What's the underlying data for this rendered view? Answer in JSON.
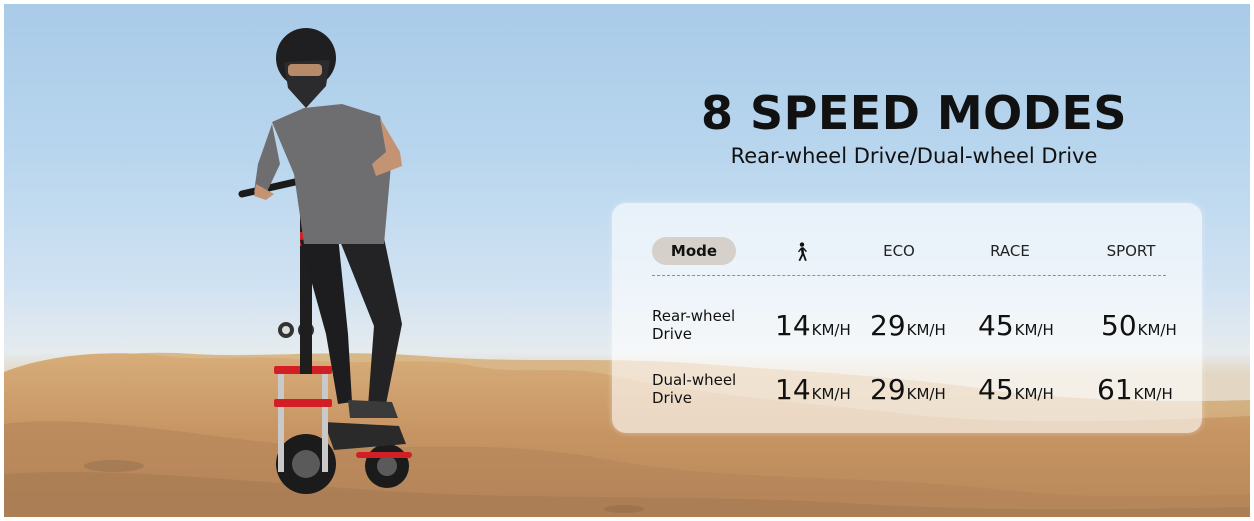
{
  "headline": "8 SPEED MODES",
  "subheadline": "Rear-wheel Drive/Dual-wheel Drive",
  "table": {
    "mode_header": "Mode",
    "walk_mode_icon": "walking-person-icon",
    "columns": [
      "ECO",
      "RACE",
      "SPORT"
    ],
    "rows": [
      {
        "label": "Rear-wheel Drive",
        "values": [
          {
            "num": "14",
            "unit": "KM/H"
          },
          {
            "num": "29",
            "unit": "KM/H"
          },
          {
            "num": "45",
            "unit": "KM/H"
          },
          {
            "num": "50",
            "unit": "KM/H"
          }
        ]
      },
      {
        "label": "Dual-wheel Drive",
        "values": [
          {
            "num": "14",
            "unit": "KM/H"
          },
          {
            "num": "29",
            "unit": "KM/H"
          },
          {
            "num": "45",
            "unit": "KM/H"
          },
          {
            "num": "61",
            "unit": "KM/H"
          }
        ]
      }
    ]
  },
  "colors": {
    "sky": "#b9d6ee",
    "sand": "#c99a66",
    "scooter_accent": "#d21f26",
    "text": "#111111"
  }
}
